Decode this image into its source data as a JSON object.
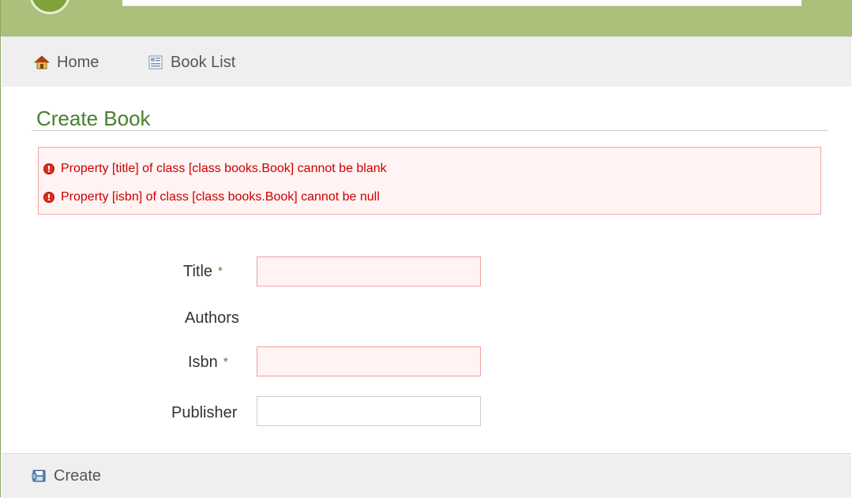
{
  "nav": {
    "home_label": "Home",
    "home_icon": "home-icon",
    "book_list_label": "Book List",
    "book_list_icon": "list-icon"
  },
  "page": {
    "title": "Create Book"
  },
  "errors": [
    "Property [title] of class [class books.Book] cannot be blank",
    "Property [isbn] of class [class books.Book] cannot be null"
  ],
  "form": {
    "title_label": "Title",
    "authors_label": "Authors",
    "isbn_label": "Isbn",
    "publisher_label": "Publisher",
    "required_marker": "*",
    "title_value": "",
    "isbn_value": "",
    "publisher_value": ""
  },
  "footer": {
    "create_label": "Create",
    "create_icon": "save-icon"
  },
  "colors": {
    "header_band": "#abc07a",
    "title": "#48802c",
    "error_text": "#cc0000",
    "error_bg": "#fff3f3",
    "error_border": "#f2a6a6",
    "toolbar_bg": "#efefef"
  }
}
